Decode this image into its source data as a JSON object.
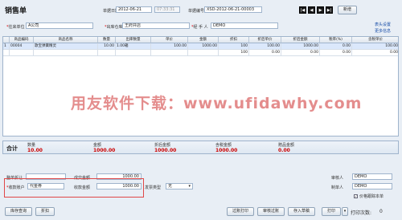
{
  "header": {
    "title": "销售单",
    "date_label": "单据日期",
    "date_value": "2012-06-21",
    "time_value": "07:33:31",
    "number_label": "单据编号",
    "number_value": "XSD-2012-06-21-00003",
    "nav_buttons": [
      "|◀",
      "◀",
      "▶",
      "▶|"
    ],
    "new_button": "新增",
    "customer_label": "往来单位",
    "customer_value": "A公司",
    "warehouse_label": "出库仓库",
    "warehouse_value": "王府井店",
    "handler_label": "经 手 人",
    "handler_value": "DEMO",
    "link_header_settings": "表头设置",
    "link_more_info": "更多信息"
  },
  "grid": {
    "columns": [
      "",
      "商品编码",
      "商品名称",
      "数量",
      "出库数量",
      "单价",
      "金额",
      "折扣",
      "折后单价",
      "折后金额",
      "税率(%)",
      "含税单价"
    ],
    "row1": [
      "1",
      "00004",
      "歌宝弹簧精灵",
      "10.00",
      "1.00箱",
      "100.00",
      "1000.00",
      "100",
      "100.00",
      "1000.00",
      "0.00",
      "100.00"
    ],
    "row2": [
      "",
      "",
      "",
      "",
      "",
      "",
      "",
      "100",
      "0.00",
      "0.00",
      "0.00",
      "0.00"
    ]
  },
  "watermark": "用友软件下载：www.ufidawhy.com",
  "totals": {
    "label": "合计",
    "qty_label": "数量",
    "qty_value": "10.00",
    "amount_label": "金额",
    "amount_value": "1000.00",
    "disc_amount_label": "折后金额",
    "disc_amount_value": "1000.00",
    "tax_amount_label": "含税金额",
    "tax_amount_value": "1000.00",
    "gift_amount_label": "赠品金额",
    "gift_amount_value": "0.00"
  },
  "footer": {
    "whole_discount_label": "整单折让",
    "deal_amount_label": "成交金额",
    "deal_amount_value": "1000.00",
    "receive_account_label": "收款账户",
    "receive_account_value": "代金券",
    "receive_amount_label": "收款金额",
    "receive_amount_value": "1000.00",
    "invoice_type_label": "发票类型",
    "invoice_type_value": "无",
    "auditor_label": "审核人",
    "auditor_value": "DEMO",
    "maker_label": "制单人",
    "maker_value": "DEMO",
    "track_cost_label": "价格跟踪本单"
  },
  "bottom_buttons": {
    "stock_check": "库存查询",
    "discount": "折扣",
    "print_post": "过账打印",
    "audit_post": "审核过账",
    "save_draft": "存入草稿",
    "print": "打印",
    "print_count_label": "打印次数:",
    "print_count_value": "0"
  },
  "colors": {
    "highlight_text": "#cc0000",
    "link": "#1b4fa8",
    "row_selected": "#dbe8fb"
  }
}
